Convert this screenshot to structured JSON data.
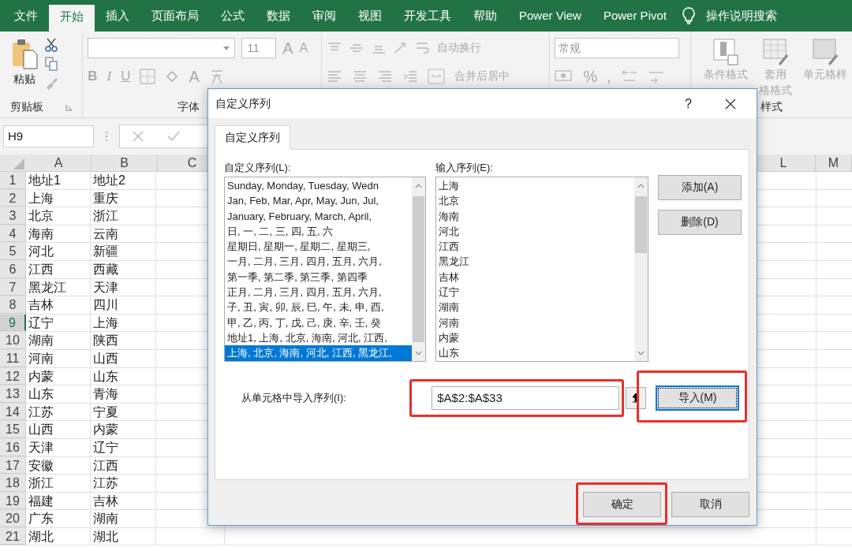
{
  "ribbon_tabs": [
    {
      "label": "文件",
      "selected": false
    },
    {
      "label": "开始",
      "selected": true
    },
    {
      "label": "插入",
      "selected": false
    },
    {
      "label": "页面布局",
      "selected": false
    },
    {
      "label": "公式",
      "selected": false
    },
    {
      "label": "数据",
      "selected": false
    },
    {
      "label": "审阅",
      "selected": false
    },
    {
      "label": "视图",
      "selected": false
    },
    {
      "label": "开发工具",
      "selected": false
    },
    {
      "label": "帮助",
      "selected": false
    },
    {
      "label": "Power View",
      "selected": false
    },
    {
      "label": "Power Pivot",
      "selected": false
    }
  ],
  "tell_me": "操作说明搜索",
  "ribbon": {
    "clipboard": {
      "paste": "粘贴",
      "label": "剪贴板"
    },
    "font": {
      "size": "11",
      "grow": "A",
      "shrink": "A",
      "bold": "B",
      "italic": "I",
      "underline": "U",
      "font_color": "A",
      "label": "字体"
    },
    "alignment": {
      "wrap_text": "自动换行",
      "merge_center": "合并后居中"
    },
    "number": {
      "format": "常规",
      "percent": "%",
      "comma": ","
    },
    "styles": {
      "conditional": "条件格式",
      "table_format_top": "套用",
      "table_format_bottom": "格格式",
      "cell_styles": "单元格样",
      "label": "样式"
    }
  },
  "formula_bar": {
    "name_box": "H9"
  },
  "sheet": {
    "left_columns": [
      "A",
      "B",
      "C"
    ],
    "right_columns": [
      "L",
      "M"
    ],
    "rows": [
      {
        "number": "1",
        "a": "地址1",
        "b": "地址2",
        "selected": false
      },
      {
        "number": "2",
        "a": "上海",
        "b": "重庆",
        "selected": false
      },
      {
        "number": "3",
        "a": "北京",
        "b": "浙江",
        "selected": false
      },
      {
        "number": "4",
        "a": "海南",
        "b": "云南",
        "selected": false
      },
      {
        "number": "5",
        "a": "河北",
        "b": "新疆",
        "selected": false
      },
      {
        "number": "6",
        "a": "江西",
        "b": "西藏",
        "selected": false
      },
      {
        "number": "7",
        "a": "黑龙江",
        "b": "天津",
        "selected": false
      },
      {
        "number": "8",
        "a": "吉林",
        "b": "四川",
        "selected": false
      },
      {
        "number": "9",
        "a": "辽宁",
        "b": "上海",
        "selected": true
      },
      {
        "number": "10",
        "a": "湖南",
        "b": "陕西",
        "selected": false
      },
      {
        "number": "11",
        "a": "河南",
        "b": "山西",
        "selected": false
      },
      {
        "number": "12",
        "a": "内蒙",
        "b": "山东",
        "selected": false
      },
      {
        "number": "13",
        "a": "山东",
        "b": "青海",
        "selected": false
      },
      {
        "number": "14",
        "a": "江苏",
        "b": "宁夏",
        "selected": false
      },
      {
        "number": "15",
        "a": "山西",
        "b": "内蒙",
        "selected": false
      },
      {
        "number": "16",
        "a": "天津",
        "b": "辽宁",
        "selected": false
      },
      {
        "number": "17",
        "a": "安徽",
        "b": "江西",
        "selected": false
      },
      {
        "number": "18",
        "a": "浙江",
        "b": "江苏",
        "selected": false
      },
      {
        "number": "19",
        "a": "福建",
        "b": "吉林",
        "selected": false
      },
      {
        "number": "20",
        "a": "广东",
        "b": "湖南",
        "selected": false
      },
      {
        "number": "21",
        "a": "湖北",
        "b": "湖北",
        "selected": false
      }
    ]
  },
  "dialog": {
    "title": "自定义序列",
    "help": "?",
    "tabs": [
      {
        "label": "自定义序列",
        "selected": true
      }
    ],
    "custom_lists_label": "自定义序列(L):",
    "custom_lists": [
      {
        "text": "Sunday, Monday, Tuesday, Wedn",
        "selected": false
      },
      {
        "text": "Jan, Feb, Mar, Apr, May, Jun, Jul,",
        "selected": false
      },
      {
        "text": "January, February, March, April,",
        "selected": false
      },
      {
        "text": "日, 一, 二, 三, 四, 五, 六",
        "selected": false
      },
      {
        "text": "星期日, 星期一, 星期二, 星期三,",
        "selected": false
      },
      {
        "text": "一月, 二月, 三月, 四月, 五月, 六月,",
        "selected": false
      },
      {
        "text": "第一季, 第二季, 第三季, 第四季",
        "selected": false
      },
      {
        "text": "正月, 二月, 三月, 四月, 五月, 六月,",
        "selected": false
      },
      {
        "text": "子, 丑, 寅, 卯, 辰, 巳, 午, 未, 申, 酉,",
        "selected": false
      },
      {
        "text": "甲, 乙, 丙, 丁, 戊, 己, 庚, 辛, 壬, 癸",
        "selected": false
      },
      {
        "text": "地址1, 上海, 北京, 海南, 河北, 江西,",
        "selected": false
      },
      {
        "text": "上海, 北京, 海南, 河北, 江西, 黑龙江,",
        "selected": true
      }
    ],
    "entries_label": "输入序列(E):",
    "entries": [
      "上海",
      "北京",
      "海南",
      "河北",
      "江西",
      "黑龙江",
      "吉林",
      "辽宁",
      "湖南",
      "河南",
      "内蒙",
      "山东"
    ],
    "side_buttons": [
      "添加(A)",
      "删除(D)"
    ],
    "import_label": "从单元格中导入序列(I):",
    "import_field": {
      "value": "$A$2:$A$33",
      "highlighted": true
    },
    "import_button": {
      "label": "导入(M)",
      "highlighted": true,
      "focused": true
    },
    "ok_button": {
      "label": "确定",
      "highlighted": true
    },
    "cancel_button": {
      "label": "取消",
      "highlighted": false
    }
  }
}
